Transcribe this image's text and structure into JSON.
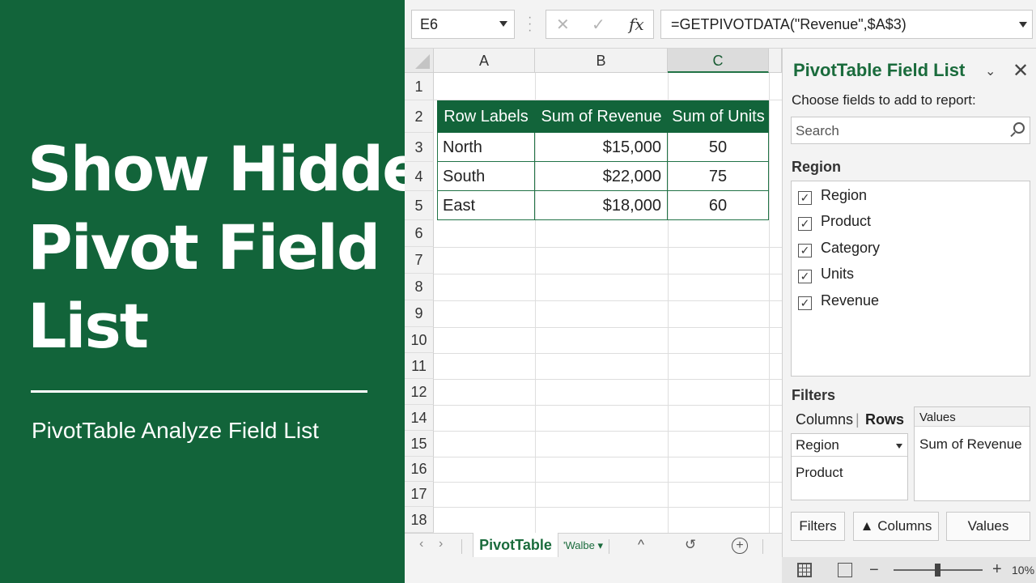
{
  "hero": {
    "title_lines": [
      "Show Hidden",
      "Pivot Field",
      "List"
    ],
    "subtitle": "PivotTable Analyze Field List",
    "bg_color": "#12643a"
  },
  "formula_bar": {
    "name_box": "E6",
    "cancel_icon": "✕",
    "enter_icon": "✓",
    "fx_label": "fx",
    "formula": "=GETPIVOTDATA(\"Revenue\",$A$3)"
  },
  "grid": {
    "columns": [
      "A",
      "B",
      "C"
    ],
    "active_column": "C",
    "row_numbers": [
      "1",
      "2",
      "3",
      "4",
      "5",
      "6",
      "7",
      "8",
      "9",
      "10",
      "11",
      "12",
      "14",
      "15",
      "16",
      "17",
      "18"
    ]
  },
  "pivot": {
    "headers": [
      "Row Labels",
      "Sum of Revenue",
      "Sum of Units"
    ],
    "rows": [
      [
        "North",
        "$15,000",
        "50"
      ],
      [
        "South",
        "$22,000",
        "75"
      ],
      [
        "East",
        "$18,000",
        "60"
      ]
    ],
    "accent": "#217346"
  },
  "sheet_tabs": {
    "prev": "‹",
    "next": "›",
    "active": "PivotTable",
    "other": "'Walbe ▾",
    "scroll_up": "^",
    "scroll_undo": "↺",
    "add": "+"
  },
  "field_list": {
    "title": "PivotTable Field List",
    "chevron": "⌄",
    "close": "✕",
    "prompt": "Choose fields to add to report:",
    "search_placeholder": "Search",
    "section": "Region",
    "fields": [
      {
        "label": "Region",
        "checked": "✓"
      },
      {
        "label": "Product",
        "checked": "✓"
      },
      {
        "label": "Category",
        "checked": "✓"
      },
      {
        "label": "Units",
        "checked": "✓"
      },
      {
        "label": "Revenue",
        "checked": "✓"
      }
    ],
    "filters_label": "Filters",
    "columns_label": "Columns",
    "separator": "|",
    "rows_label": "Rows",
    "rows_items": [
      "Region",
      "Product"
    ],
    "values_label": "Values",
    "values_items": [
      "Sum of Revenue"
    ],
    "buttons": [
      "Filters",
      "Columns",
      "Values"
    ]
  },
  "status": {
    "minus": "−",
    "plus": "+",
    "zoom": "10%"
  }
}
